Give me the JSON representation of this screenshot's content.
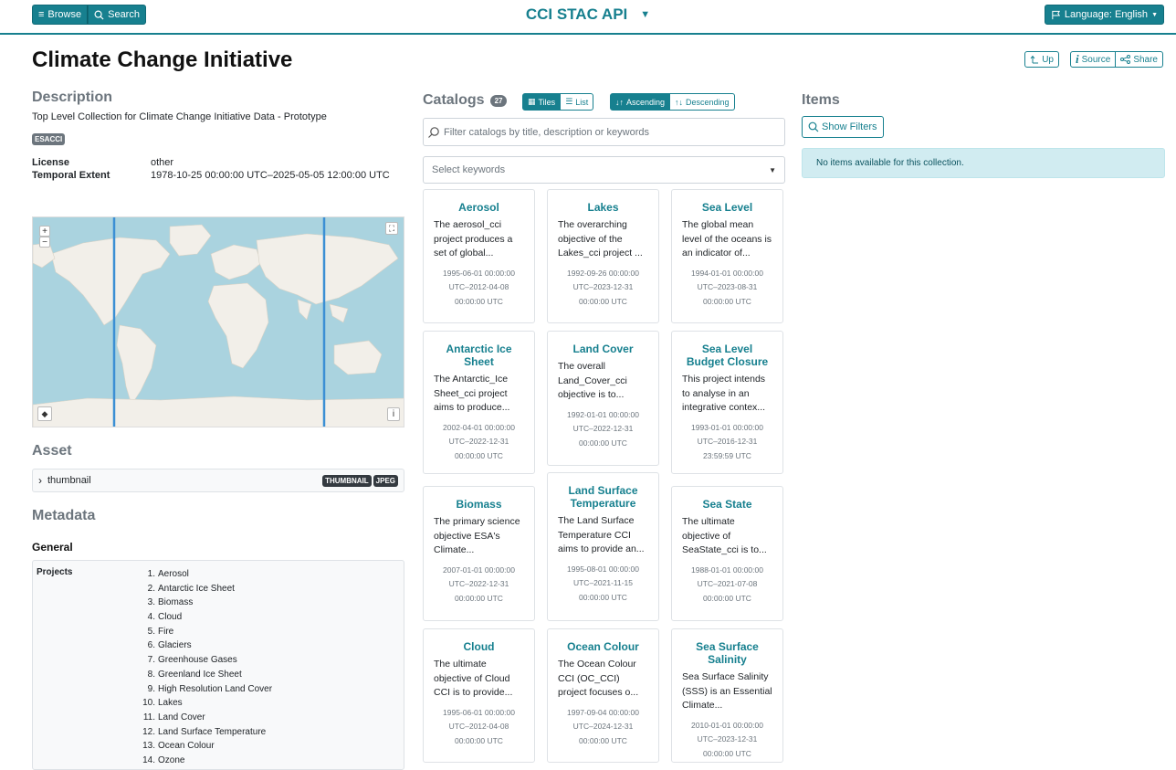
{
  "topbar": {
    "browse": "Browse",
    "search": "Search",
    "app_title": "CCI STAC API",
    "language": "Language: English"
  },
  "header": {
    "title": "Climate Change Initiative",
    "up": "Up",
    "source": "Source",
    "share": "Share"
  },
  "description": {
    "heading": "Description",
    "text": "Top Level Collection for Climate Change Initiative Data - Prototype",
    "keyword_badge": "ESACCI",
    "license_label": "License",
    "license_value": "other",
    "temporal_label": "Temporal Extent",
    "temporal_value": "1978-10-25 00:00:00 UTC–2025-05-05 12:00:00 UTC"
  },
  "map": {
    "zoom_in": "+",
    "zoom_out": "−",
    "info": "i"
  },
  "asset": {
    "heading": "Asset",
    "name": "thumbnail",
    "badges": [
      "THUMBNAIL",
      "JPEG"
    ]
  },
  "metadata": {
    "heading": "Metadata",
    "general_heading": "General",
    "projects_label": "Projects",
    "projects": [
      {
        "n": "1.",
        "name": "Aerosol"
      },
      {
        "n": "2.",
        "name": "Antarctic Ice Sheet"
      },
      {
        "n": "3.",
        "name": "Biomass"
      },
      {
        "n": "4.",
        "name": "Cloud"
      },
      {
        "n": "5.",
        "name": "Fire"
      },
      {
        "n": "6.",
        "name": "Glaciers"
      },
      {
        "n": "7.",
        "name": "Greenhouse Gases"
      },
      {
        "n": "8.",
        "name": "Greenland Ice Sheet"
      },
      {
        "n": "9.",
        "name": "High Resolution Land Cover"
      },
      {
        "n": "10.",
        "name": "Lakes"
      },
      {
        "n": "11.",
        "name": "Land Cover"
      },
      {
        "n": "12.",
        "name": "Land Surface Temperature"
      },
      {
        "n": "13.",
        "name": "Ocean Colour"
      },
      {
        "n": "14.",
        "name": "Ozone"
      }
    ]
  },
  "catalogs": {
    "heading": "Catalogs",
    "count": "27",
    "tiles": "Tiles",
    "list": "List",
    "ascending": "Ascending",
    "descending": "Descending",
    "filter_placeholder": "Filter catalogs by title, description or keywords",
    "keywords_placeholder": "Select keywords",
    "cards": [
      {
        "title": "Aerosol",
        "desc": "The aerosol_cci project produces a set of global...",
        "dates": "1995-06-01 00:00:00 UTC–2012-04-08 00:00:00 UTC"
      },
      {
        "title": "Lakes",
        "desc": "The overarching objective of the Lakes_cci project ...",
        "dates": "1992-09-26 00:00:00 UTC–2023-12-31 00:00:00 UTC"
      },
      {
        "title": "Sea Level",
        "desc": "The global mean level of the oceans is an indicator of...",
        "dates": "1994-01-01 00:00:00 UTC–2023-08-31 00:00:00 UTC"
      },
      {
        "title": "Antarctic Ice Sheet",
        "desc": "The Antarctic_Ice Sheet_cci project aims to produce...",
        "dates": "2002-04-01 00:00:00 UTC–2022-12-31 00:00:00 UTC"
      },
      {
        "title": "Land Cover",
        "desc": "The overall Land_Cover_cci objective is to...",
        "dates": "1992-01-01 00:00:00 UTC–2022-12-31 00:00:00 UTC"
      },
      {
        "title": "Sea Level Budget Closure",
        "desc": "This project intends to analyse in an integrative contex...",
        "dates": "1993-01-01 00:00:00 UTC–2016-12-31 23:59:59 UTC"
      },
      {
        "title": "Biomass",
        "desc": "The primary science objective ESA's Climate...",
        "dates": "2007-01-01 00:00:00 UTC–2022-12-31 00:00:00 UTC"
      },
      {
        "title": "Land Surface Temperature",
        "desc": "The Land Surface Temperature CCI aims to provide an...",
        "dates": "1995-08-01 00:00:00 UTC–2021-11-15 00:00:00 UTC"
      },
      {
        "title": "Sea State",
        "desc": "The ultimate objective of SeaState_cci is to...",
        "dates": "1988-01-01 00:00:00 UTC–2021-07-08 00:00:00 UTC"
      },
      {
        "title": "Cloud",
        "desc": "The ultimate objective of Cloud CCI is to provide...",
        "dates": "1995-06-01 00:00:00 UTC–2012-04-08 00:00:00 UTC"
      },
      {
        "title": "Ocean Colour",
        "desc": "The Ocean Colour CCI (OC_CCI) project focuses o...",
        "dates": "1997-09-04 00:00:00 UTC–2024-12-31 00:00:00 UTC"
      },
      {
        "title": "Sea Surface Salinity",
        "desc": "Sea Surface Salinity (SSS) is an Essential Climate...",
        "dates": "2010-01-01 00:00:00 UTC–2023-12-31 00:00:00 UTC"
      }
    ]
  },
  "items": {
    "heading": "Items",
    "show_filters": "Show Filters",
    "empty_message": "No items available for this collection."
  },
  "colors": {
    "accent": "#17808f",
    "info_bg": "#d1ecf1",
    "map_water": "#aad3df",
    "map_land": "#f2efe9"
  }
}
